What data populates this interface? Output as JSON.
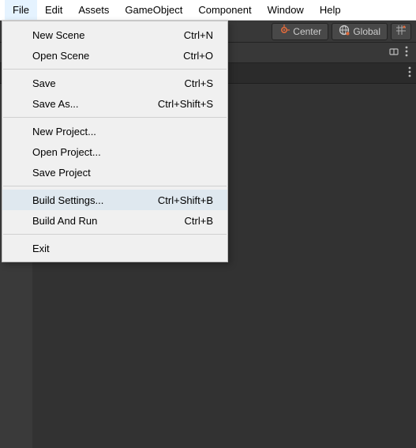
{
  "menus": [
    "File",
    "Edit",
    "Assets",
    "GameObject",
    "Component",
    "Window",
    "Help"
  ],
  "active_menu_index": 0,
  "file_menu": [
    {
      "label": "New Scene",
      "shortcut": "Ctrl+N",
      "hl": false
    },
    {
      "label": "Open Scene",
      "shortcut": "Ctrl+O",
      "hl": false
    },
    {
      "sep": true
    },
    {
      "label": "Save",
      "shortcut": "Ctrl+S",
      "hl": false
    },
    {
      "label": "Save As...",
      "shortcut": "Ctrl+Shift+S",
      "hl": false
    },
    {
      "sep": true
    },
    {
      "label": "New Project...",
      "shortcut": "",
      "hl": false
    },
    {
      "label": "Open Project...",
      "shortcut": "",
      "hl": false
    },
    {
      "label": "Save Project",
      "shortcut": "",
      "hl": false
    },
    {
      "sep": true
    },
    {
      "label": "Build Settings...",
      "shortcut": "Ctrl+Shift+B",
      "hl": true
    },
    {
      "label": "Build And Run",
      "shortcut": "Ctrl+B",
      "hl": false
    },
    {
      "sep": true
    },
    {
      "label": "Exit",
      "shortcut": "",
      "hl": false
    }
  ],
  "toolbar": {
    "pivot": "Center",
    "handle": "Global"
  }
}
